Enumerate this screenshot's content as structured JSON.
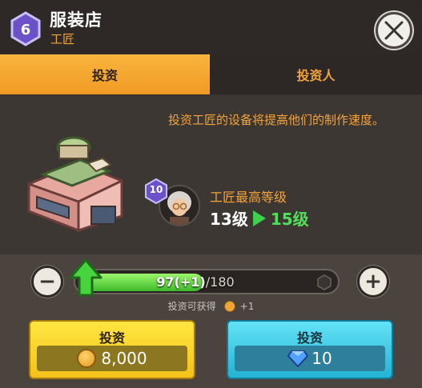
{
  "header": {
    "level": "6",
    "title": "服装店",
    "subtitle": "工匠",
    "close_icon": "close-icon"
  },
  "tabs": [
    {
      "label": "投资",
      "active": true
    },
    {
      "label": "投资人",
      "active": false
    }
  ],
  "main": {
    "description": "投资工匠的设备将提高他们的制作速度。",
    "craftsman": {
      "level": "10",
      "max_level_label": "工匠最高等级",
      "current_level": "13级",
      "next_level": "15级"
    }
  },
  "footer": {
    "progress": {
      "current": 97,
      "bonus": "(+1)",
      "max": "/180",
      "fraction": 0.539
    },
    "gain_label": "投资可获得",
    "gain_value": "+1",
    "gold_button": {
      "label": "投资",
      "cost": "8,000"
    },
    "gem_button": {
      "label": "投资",
      "cost": "10"
    }
  },
  "colors": {
    "accent_orange": "#f2a33a",
    "progress_green": "#3dbb2c",
    "gold_button": "#f3c11a",
    "gem_button": "#23b3d4"
  }
}
